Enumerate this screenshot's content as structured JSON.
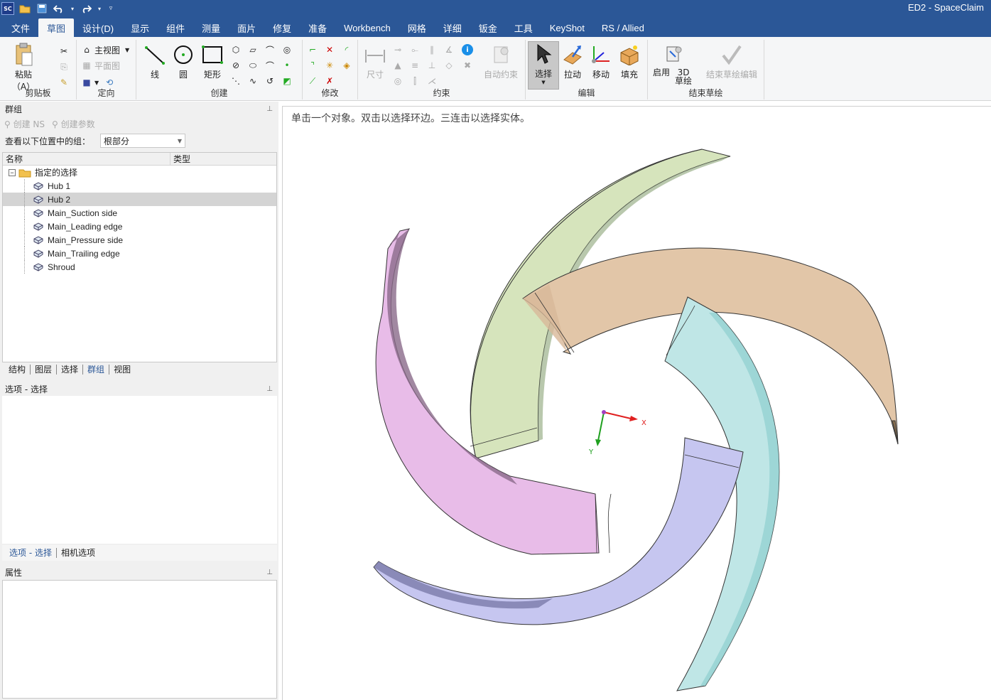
{
  "app": {
    "title": "ED2 - SpaceClaim",
    "logo": "SC"
  },
  "menu_tabs": [
    "文件",
    "草图",
    "设计(D)",
    "显示",
    "组件",
    "测量",
    "面片",
    "修复",
    "准备",
    "Workbench",
    "网格",
    "详细",
    "钣金",
    "工具",
    "KeyShot",
    "RS / Allied"
  ],
  "ribbon": {
    "clipboard": {
      "label": "剪贴板",
      "paste": "粘贴（A）"
    },
    "orient": {
      "label": "定向",
      "home": "主视图",
      "plan": "平面图"
    },
    "create": {
      "label": "创建",
      "line": "线",
      "circle": "圆",
      "rect": "矩形"
    },
    "modify": {
      "label": "修改"
    },
    "constrain": {
      "label": "约束",
      "dimension": "尺寸",
      "auto": "自动约束"
    },
    "edit": {
      "label": "编辑",
      "select": "选择",
      "pull": "拉动",
      "move": "移动",
      "fill": "填充"
    },
    "finish": {
      "label": "结束草绘",
      "enable3d": "启用",
      "sketch3d": "3D 草绘",
      "end": "结束草绘编辑"
    }
  },
  "groups_panel": {
    "title": "群组",
    "create_ns": "创建 NS",
    "create_param": "创建参数",
    "look_label": "查看以下位置中的组：",
    "look_value": "根部分",
    "col_name": "名称",
    "col_type": "类型",
    "folder": "指定的选择",
    "items": [
      "Hub 1",
      "Hub 2",
      "Main_Suction side",
      "Main_Leading edge",
      "Main_Pressure side",
      "Main_Trailing edge",
      "Shroud"
    ],
    "selected_item": "Hub 2",
    "bottom_tabs": [
      "结构",
      "图层",
      "选择",
      "群组",
      "视图"
    ],
    "active_tab": "群组"
  },
  "options_panel": {
    "title": "选项 - 选择",
    "tabs": [
      "选项 - 选择",
      "相机选项"
    ]
  },
  "properties_panel": {
    "title": "属性"
  },
  "viewport": {
    "hint": "单击一个对象。双击以选择环边。三连击以选择实体。",
    "axis_x": "X",
    "axis_y": "Y",
    "colors": {
      "blade_green": "#dde8c4",
      "blade_tan": "#e6d0b8",
      "blade_pink": "#e8b8e8",
      "blade_cyan": "#c4ecec",
      "blade_blue": "#c8c8f2"
    }
  }
}
